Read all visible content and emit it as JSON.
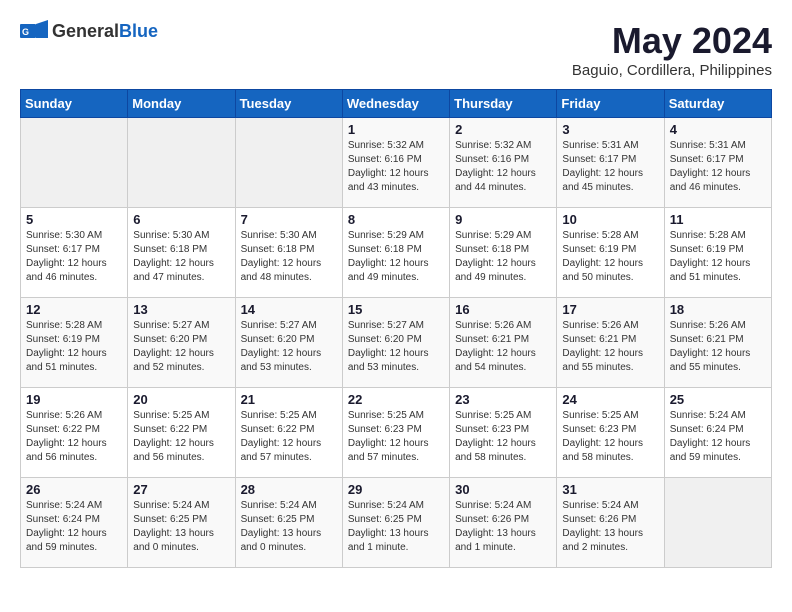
{
  "header": {
    "logo_general": "General",
    "logo_blue": "Blue",
    "month_title": "May 2024",
    "subtitle": "Baguio, Cordillera, Philippines"
  },
  "days_of_week": [
    "Sunday",
    "Monday",
    "Tuesday",
    "Wednesday",
    "Thursday",
    "Friday",
    "Saturday"
  ],
  "weeks": [
    [
      {
        "day": "",
        "info": ""
      },
      {
        "day": "",
        "info": ""
      },
      {
        "day": "",
        "info": ""
      },
      {
        "day": "1",
        "info": "Sunrise: 5:32 AM\nSunset: 6:16 PM\nDaylight: 12 hours\nand 43 minutes."
      },
      {
        "day": "2",
        "info": "Sunrise: 5:32 AM\nSunset: 6:16 PM\nDaylight: 12 hours\nand 44 minutes."
      },
      {
        "day": "3",
        "info": "Sunrise: 5:31 AM\nSunset: 6:17 PM\nDaylight: 12 hours\nand 45 minutes."
      },
      {
        "day": "4",
        "info": "Sunrise: 5:31 AM\nSunset: 6:17 PM\nDaylight: 12 hours\nand 46 minutes."
      }
    ],
    [
      {
        "day": "5",
        "info": "Sunrise: 5:30 AM\nSunset: 6:17 PM\nDaylight: 12 hours\nand 46 minutes."
      },
      {
        "day": "6",
        "info": "Sunrise: 5:30 AM\nSunset: 6:18 PM\nDaylight: 12 hours\nand 47 minutes."
      },
      {
        "day": "7",
        "info": "Sunrise: 5:30 AM\nSunset: 6:18 PM\nDaylight: 12 hours\nand 48 minutes."
      },
      {
        "day": "8",
        "info": "Sunrise: 5:29 AM\nSunset: 6:18 PM\nDaylight: 12 hours\nand 49 minutes."
      },
      {
        "day": "9",
        "info": "Sunrise: 5:29 AM\nSunset: 6:18 PM\nDaylight: 12 hours\nand 49 minutes."
      },
      {
        "day": "10",
        "info": "Sunrise: 5:28 AM\nSunset: 6:19 PM\nDaylight: 12 hours\nand 50 minutes."
      },
      {
        "day": "11",
        "info": "Sunrise: 5:28 AM\nSunset: 6:19 PM\nDaylight: 12 hours\nand 51 minutes."
      }
    ],
    [
      {
        "day": "12",
        "info": "Sunrise: 5:28 AM\nSunset: 6:19 PM\nDaylight: 12 hours\nand 51 minutes."
      },
      {
        "day": "13",
        "info": "Sunrise: 5:27 AM\nSunset: 6:20 PM\nDaylight: 12 hours\nand 52 minutes."
      },
      {
        "day": "14",
        "info": "Sunrise: 5:27 AM\nSunset: 6:20 PM\nDaylight: 12 hours\nand 53 minutes."
      },
      {
        "day": "15",
        "info": "Sunrise: 5:27 AM\nSunset: 6:20 PM\nDaylight: 12 hours\nand 53 minutes."
      },
      {
        "day": "16",
        "info": "Sunrise: 5:26 AM\nSunset: 6:21 PM\nDaylight: 12 hours\nand 54 minutes."
      },
      {
        "day": "17",
        "info": "Sunrise: 5:26 AM\nSunset: 6:21 PM\nDaylight: 12 hours\nand 55 minutes."
      },
      {
        "day": "18",
        "info": "Sunrise: 5:26 AM\nSunset: 6:21 PM\nDaylight: 12 hours\nand 55 minutes."
      }
    ],
    [
      {
        "day": "19",
        "info": "Sunrise: 5:26 AM\nSunset: 6:22 PM\nDaylight: 12 hours\nand 56 minutes."
      },
      {
        "day": "20",
        "info": "Sunrise: 5:25 AM\nSunset: 6:22 PM\nDaylight: 12 hours\nand 56 minutes."
      },
      {
        "day": "21",
        "info": "Sunrise: 5:25 AM\nSunset: 6:22 PM\nDaylight: 12 hours\nand 57 minutes."
      },
      {
        "day": "22",
        "info": "Sunrise: 5:25 AM\nSunset: 6:23 PM\nDaylight: 12 hours\nand 57 minutes."
      },
      {
        "day": "23",
        "info": "Sunrise: 5:25 AM\nSunset: 6:23 PM\nDaylight: 12 hours\nand 58 minutes."
      },
      {
        "day": "24",
        "info": "Sunrise: 5:25 AM\nSunset: 6:23 PM\nDaylight: 12 hours\nand 58 minutes."
      },
      {
        "day": "25",
        "info": "Sunrise: 5:24 AM\nSunset: 6:24 PM\nDaylight: 12 hours\nand 59 minutes."
      }
    ],
    [
      {
        "day": "26",
        "info": "Sunrise: 5:24 AM\nSunset: 6:24 PM\nDaylight: 12 hours\nand 59 minutes."
      },
      {
        "day": "27",
        "info": "Sunrise: 5:24 AM\nSunset: 6:25 PM\nDaylight: 13 hours\nand 0 minutes."
      },
      {
        "day": "28",
        "info": "Sunrise: 5:24 AM\nSunset: 6:25 PM\nDaylight: 13 hours\nand 0 minutes."
      },
      {
        "day": "29",
        "info": "Sunrise: 5:24 AM\nSunset: 6:25 PM\nDaylight: 13 hours\nand 1 minute."
      },
      {
        "day": "30",
        "info": "Sunrise: 5:24 AM\nSunset: 6:26 PM\nDaylight: 13 hours\nand 1 minute."
      },
      {
        "day": "31",
        "info": "Sunrise: 5:24 AM\nSunset: 6:26 PM\nDaylight: 13 hours\nand 2 minutes."
      },
      {
        "day": "",
        "info": ""
      }
    ]
  ]
}
